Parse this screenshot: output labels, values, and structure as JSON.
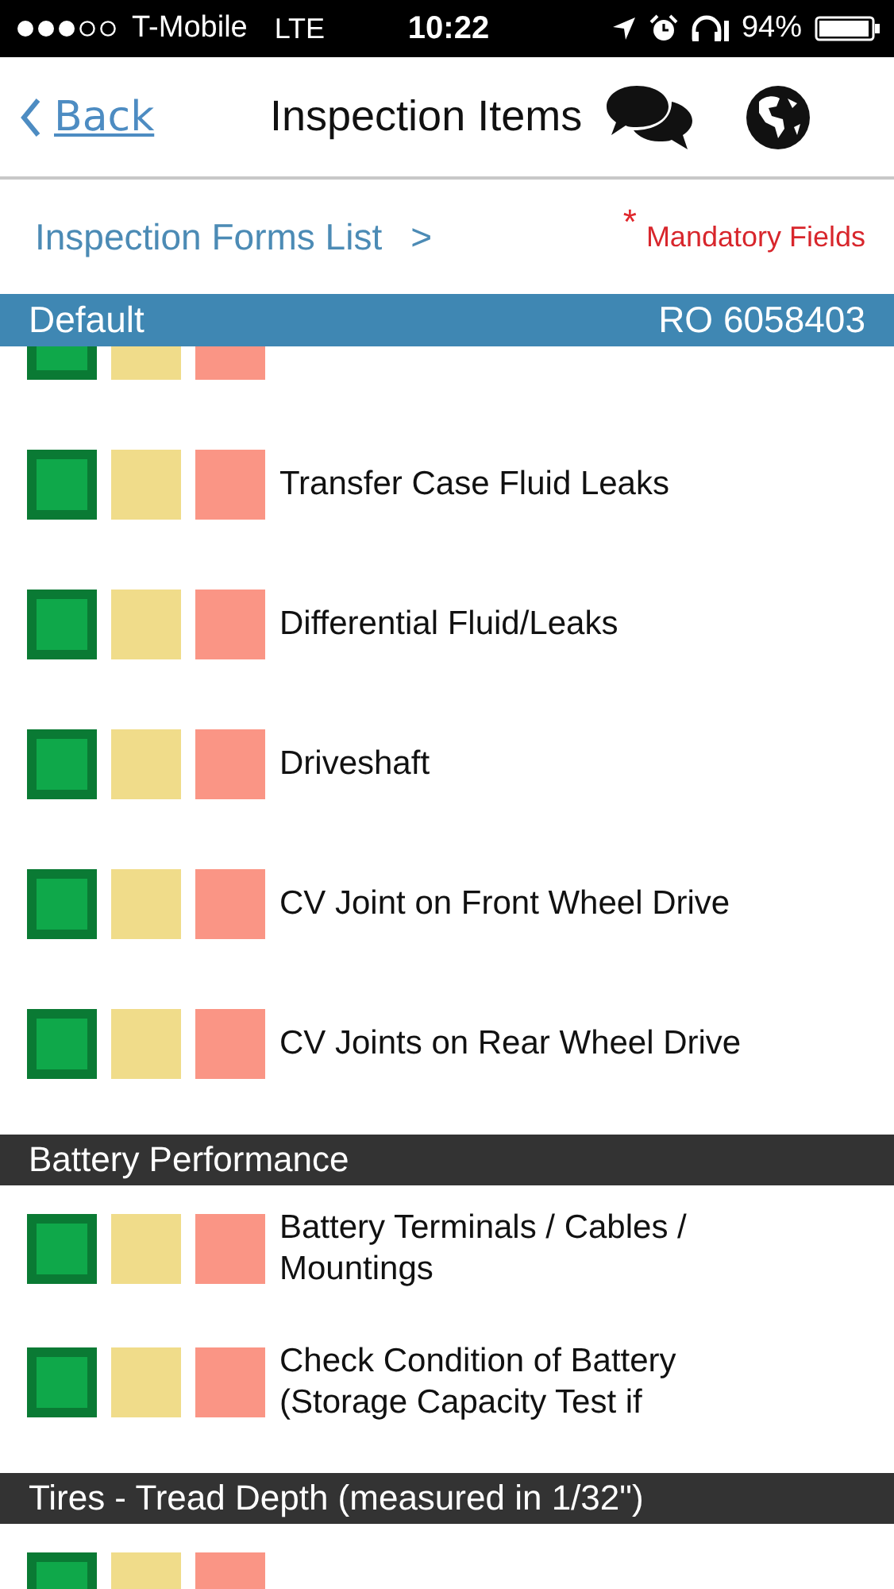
{
  "status_bar": {
    "carrier": "T-Mobile",
    "network": "LTE",
    "time": "10:22",
    "battery": "94%"
  },
  "nav": {
    "back": "Back",
    "title": "Inspection Items"
  },
  "breadcrumb": {
    "link": "Inspection Forms List",
    "separator": ">",
    "mandatory_mark": "*",
    "mandatory": "Mandatory Fields"
  },
  "band": {
    "left": "Default",
    "right": "RO 6058403"
  },
  "sections": [
    {
      "items": [
        {
          "ratings": [
            {
              "color": "#0fa84a",
              "selected": true
            },
            {
              "color": "#f0dc8a",
              "selected": false
            },
            {
              "color": "#fa9585",
              "selected": false
            }
          ]
        },
        {
          "label": "Transfer Case Fluid Leaks",
          "ratings": [
            {
              "color": "#0fa84a",
              "selected": true
            },
            {
              "color": "#f0dc8a",
              "selected": false
            },
            {
              "color": "#fa9585",
              "selected": false
            }
          ]
        },
        {
          "label": "Differential Fluid/Leaks",
          "ratings": [
            {
              "color": "#0fa84a",
              "selected": true
            },
            {
              "color": "#f0dc8a",
              "selected": false
            },
            {
              "color": "#fa9585",
              "selected": false
            }
          ]
        },
        {
          "label": "Driveshaft",
          "ratings": [
            {
              "color": "#0fa84a",
              "selected": true
            },
            {
              "color": "#f0dc8a",
              "selected": false
            },
            {
              "color": "#fa9585",
              "selected": false
            }
          ]
        },
        {
          "label": "CV Joint on Front Wheel Drive",
          "ratings": [
            {
              "color": "#0fa84a",
              "selected": true
            },
            {
              "color": "#f0dc8a",
              "selected": false
            },
            {
              "color": "#fa9585",
              "selected": false
            }
          ]
        },
        {
          "label": "CV Joints on Rear Wheel Drive",
          "ratings": [
            {
              "color": "#0fa84a",
              "selected": true
            },
            {
              "color": "#f0dc8a",
              "selected": false
            },
            {
              "color": "#fa9585",
              "selected": false
            }
          ]
        }
      ]
    },
    {
      "title": "Battery Performance",
      "items": [
        {
          "label": "Battery Terminals / Cables / Mountings",
          "ratings": [
            {
              "color": "#0fa84a",
              "selected": true
            },
            {
              "color": "#f0dc8a",
              "selected": false
            },
            {
              "color": "#fa9585",
              "selected": false
            }
          ]
        },
        {
          "label": "Check Condition of Battery (Storage Capacity Test if",
          "ratings": [
            {
              "color": "#0fa84a",
              "selected": true
            },
            {
              "color": "#f0dc8a",
              "selected": false
            },
            {
              "color": "#fa9585",
              "selected": false
            }
          ]
        }
      ]
    },
    {
      "title": "Tires - Tread Depth (measured in 1/32\")",
      "items": [
        {
          "ratings": [
            {
              "color": "#0fa84a",
              "selected": true
            },
            {
              "color": "#f0dc8a",
              "selected": false
            },
            {
              "color": "#fa9585",
              "selected": false
            }
          ]
        }
      ]
    }
  ]
}
